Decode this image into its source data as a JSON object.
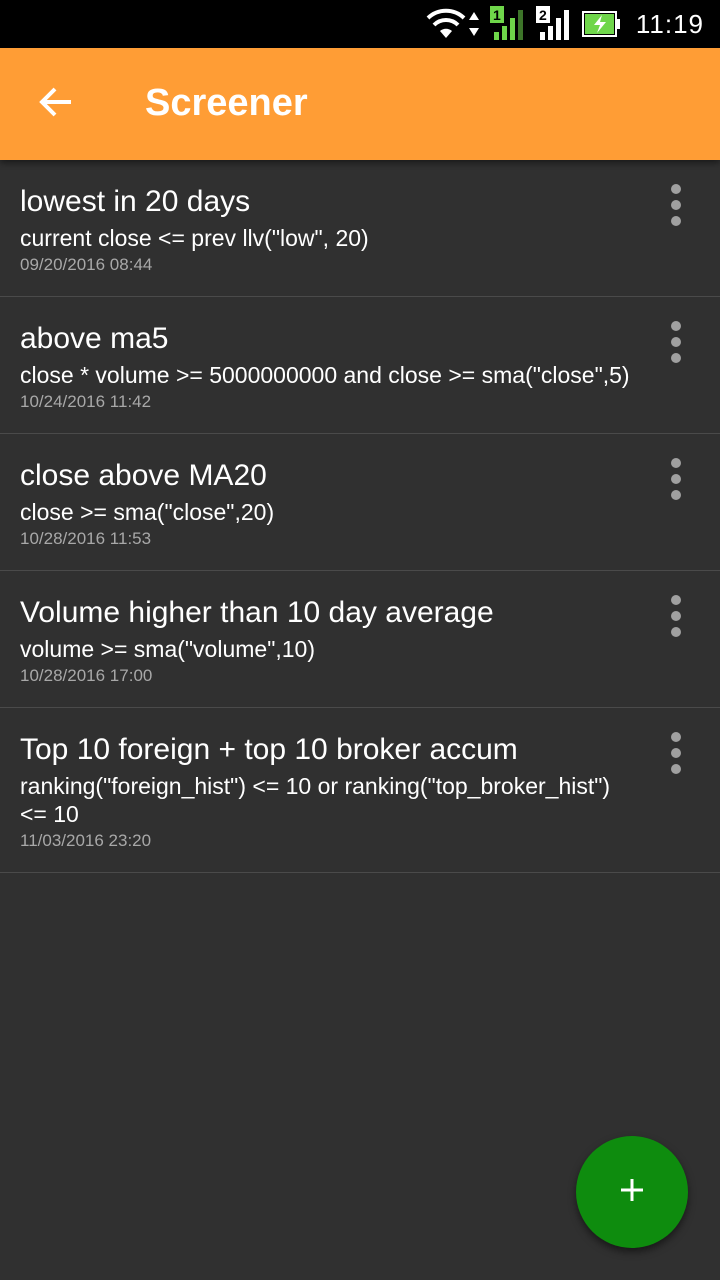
{
  "status_bar": {
    "time": "11:19",
    "icons": [
      "wifi-icon",
      "data-arrows-icon",
      "sim1-signal-icon",
      "sim2-signal-icon",
      "battery-charging-icon"
    ],
    "sim1_label": "1",
    "sim2_label": "2",
    "battery_color": "#6fd64a"
  },
  "app_bar": {
    "title": "Screener",
    "back_icon": "arrow-back-icon",
    "color": "#ff9d35"
  },
  "screeners": [
    {
      "title": "lowest in 20 days",
      "expression": "current close <= prev llv(\"low\", 20)",
      "date": "09/20/2016 08:44"
    },
    {
      "title": "above ma5",
      "expression": "close * volume >= 5000000000 and close >= sma(\"close\",5)",
      "date": "10/24/2016 11:42"
    },
    {
      "title": "close above MA20",
      "expression": "close >= sma(\"close\",20)",
      "date": "10/28/2016 11:53"
    },
    {
      "title": "Volume higher than 10 day average",
      "expression": "volume >= sma(\"volume\",10)",
      "date": "10/28/2016 17:00"
    },
    {
      "title": "Top 10 foreign + top 10 broker accum",
      "expression": "ranking(\"foreign_hist\") <= 10 or ranking(\"top_broker_hist\") <= 10",
      "date": "11/03/2016 23:20"
    }
  ],
  "fab": {
    "icon": "plus-icon",
    "color": "#0e8c0e"
  }
}
